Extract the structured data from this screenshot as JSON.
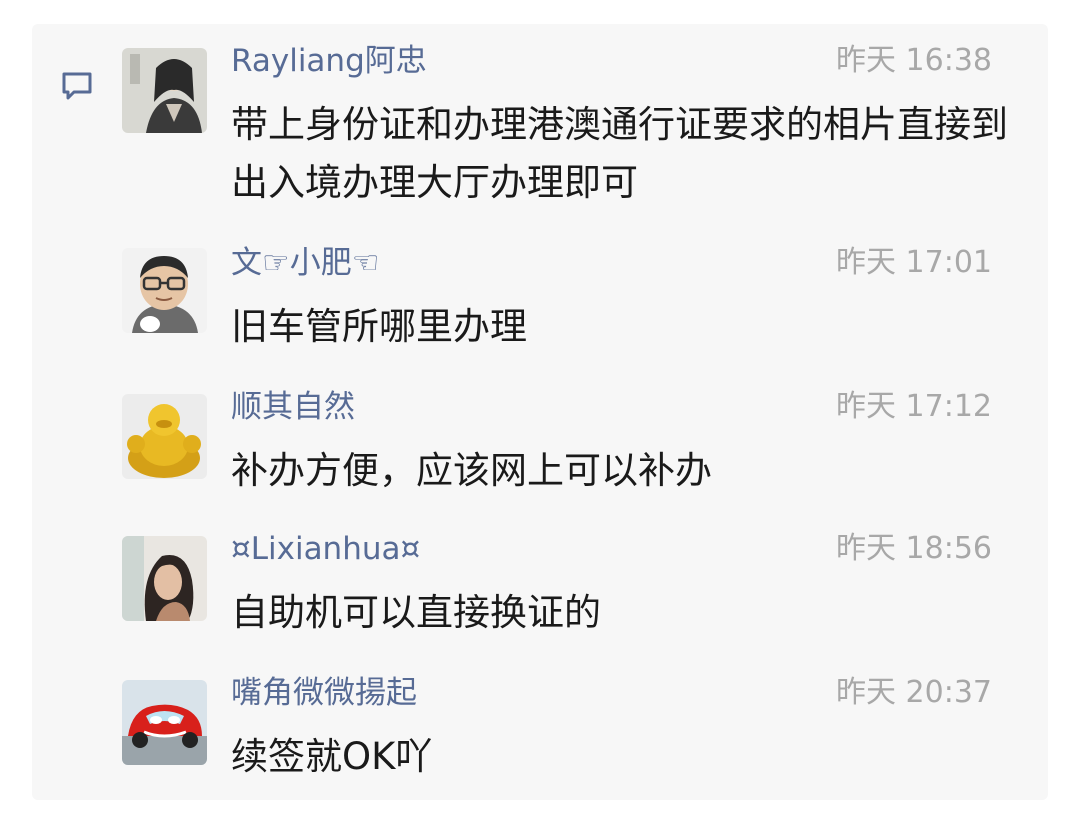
{
  "comments": [
    {
      "avatar": "ink-painting-swordsman-avatar",
      "name": "Rayliang阿忠",
      "time": "昨天 16:38",
      "text": "带上身份证和办理港澳通行证要求的相片直接到出入境办理大厅办理即可"
    },
    {
      "avatar": "cartoon-man-glasses-avatar",
      "name": "文☞小肥☜",
      "time": "昨天 17:01",
      "text": "旧车管所哪里办理"
    },
    {
      "avatar": "golden-buddha-statue-avatar",
      "name": "顺其自然",
      "time": "昨天 17:12",
      "text": "补办方便，应该网上可以补办"
    },
    {
      "avatar": "woman-photo-avatar",
      "name": "¤Lixianhua¤",
      "time": "昨天 18:56",
      "text": "自助机可以直接换证的"
    },
    {
      "avatar": "red-race-car-avatar",
      "name": "嘴角微微揚起",
      "time": "昨天 20:37",
      "text": "续签就OK吖"
    }
  ],
  "colors": {
    "name": "#576b95",
    "time": "#a8a8a8",
    "text": "#1a1a1a",
    "panel": "#f7f7f7"
  },
  "icons": {
    "section": "comment-icon"
  }
}
